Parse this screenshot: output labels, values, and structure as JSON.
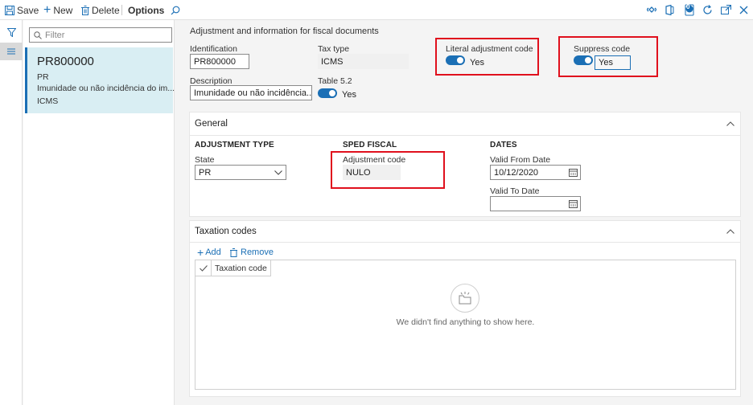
{
  "toolbar": {
    "save_label": "Save",
    "new_label": "New",
    "delete_label": "Delete",
    "options_label": "Options",
    "notification_count": "0"
  },
  "filter": {
    "placeholder": "Filter"
  },
  "list": {
    "items": [
      {
        "title": "PR800000",
        "line1": "PR",
        "line2": "Imunidade ou não incidência do im...",
        "line3": "ICMS"
      }
    ]
  },
  "header": {
    "title": "Adjustment and information for fiscal documents",
    "identification_label": "Identification",
    "identification_value": "PR800000",
    "tax_type_label": "Tax type",
    "tax_type_value": "ICMS",
    "description_label": "Description",
    "description_value": "Imunidade ou não incidência...",
    "table52_label": "Table 5.2",
    "table52_value": "Yes",
    "literal_label": "Literal adjustment code",
    "literal_value": "Yes",
    "suppress_label": "Suppress code",
    "suppress_value": "Yes"
  },
  "general": {
    "title": "General",
    "adjustment_type_title": "ADJUSTMENT TYPE",
    "state_label": "State",
    "state_value": "PR",
    "sped_title": "SPED FISCAL",
    "adjustment_code_label": "Adjustment code",
    "adjustment_code_value": "NULO",
    "dates_title": "DATES",
    "valid_from_label": "Valid From Date",
    "valid_from_value": "10/12/2020",
    "valid_to_label": "Valid To Date",
    "valid_to_value": ""
  },
  "taxation": {
    "title": "Taxation codes",
    "add_label": "Add",
    "remove_label": "Remove",
    "column_header": "Taxation code",
    "empty_message": "We didn't find anything to show here."
  },
  "colors": {
    "accent": "#1b6fb5",
    "highlight": "#e0101d",
    "selected": "#d9eef3"
  }
}
